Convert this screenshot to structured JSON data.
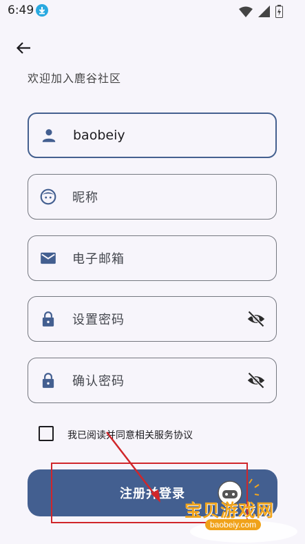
{
  "status_bar": {
    "time": "6:49"
  },
  "header": {
    "subtitle": "欢迎加入鹿谷社区"
  },
  "form": {
    "username": {
      "value": "baobeiy"
    },
    "nickname": {
      "placeholder": "昵称"
    },
    "email": {
      "placeholder": "电子邮箱"
    },
    "password": {
      "placeholder": "设置密码"
    },
    "confirm_password": {
      "placeholder": "确认密码"
    }
  },
  "agreement": {
    "label": "我已阅读并同意相关服务协议",
    "checked": false
  },
  "submit": {
    "label": "注册并登录"
  },
  "watermark": {
    "text": "宝贝游戏网",
    "url": "baobeiy.com"
  },
  "colors": {
    "primary": "#435f90",
    "outline": "#74777f",
    "annotation": "#d0262a"
  },
  "icons": [
    "download-icon",
    "wifi-icon",
    "signal-icon",
    "battery-icon",
    "back-arrow-icon",
    "person-icon",
    "face-icon",
    "mail-icon",
    "lock-icon",
    "visibility-off-icon"
  ]
}
